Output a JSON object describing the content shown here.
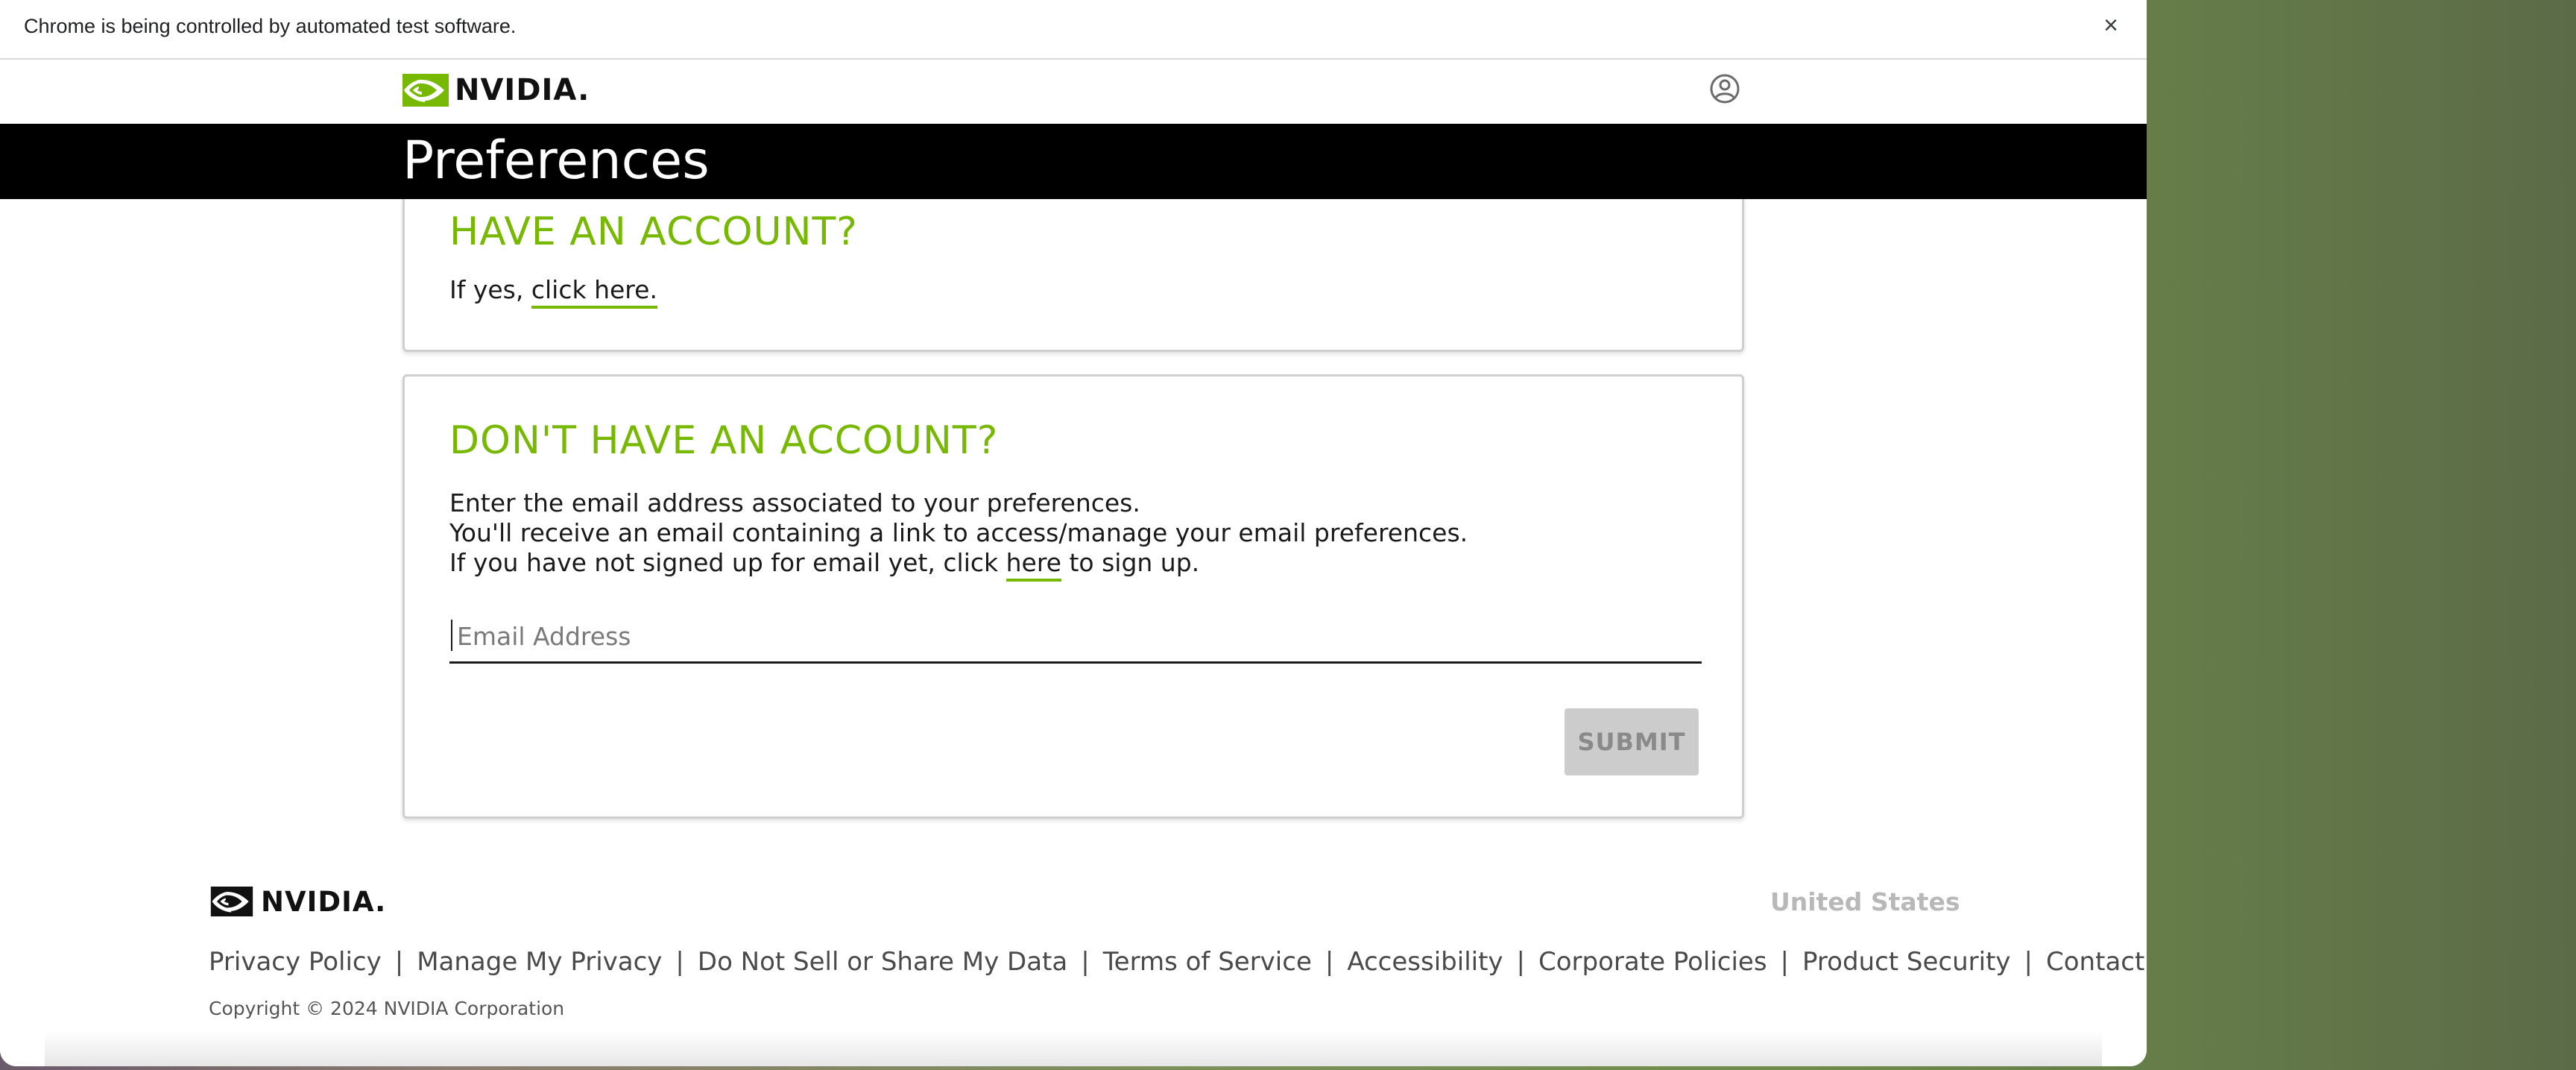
{
  "infobar": {
    "text": "Chrome is being controlled by automated test software.",
    "close": "×"
  },
  "header": {
    "logo_text": "NVIDIA.",
    "account_icon": "user-circle-icon"
  },
  "banner": {
    "title": "Preferences"
  },
  "have_account": {
    "title": "HAVE AN ACCOUNT?",
    "prefix": "If yes, ",
    "link": "click here."
  },
  "no_account": {
    "title": "DON'T HAVE AN ACCOUNT?",
    "line1": "Enter the email address associated to your preferences.",
    "line2": "You'll receive an email containing a link to access/manage your email preferences.",
    "line3_before": "If you have not signed up for email yet, click ",
    "line3_link": "here",
    "line3_after": " to sign up.",
    "email_placeholder": "Email Address",
    "email_value": "",
    "submit": "SUBMIT"
  },
  "footer": {
    "logo_text": "NVIDIA.",
    "region": "United States",
    "links": [
      "Privacy Policy",
      "Manage My Privacy",
      "Do Not Sell or Share My Data",
      "Terms of Service",
      "Accessibility",
      "Corporate Policies",
      "Product Security",
      "Contact"
    ],
    "separator": "|",
    "copyright": "Copyright © 2024 NVIDIA Corporation"
  },
  "colors": {
    "accent": "#76b900",
    "banner_bg": "#000000",
    "submit_disabled": "#cccccc"
  }
}
